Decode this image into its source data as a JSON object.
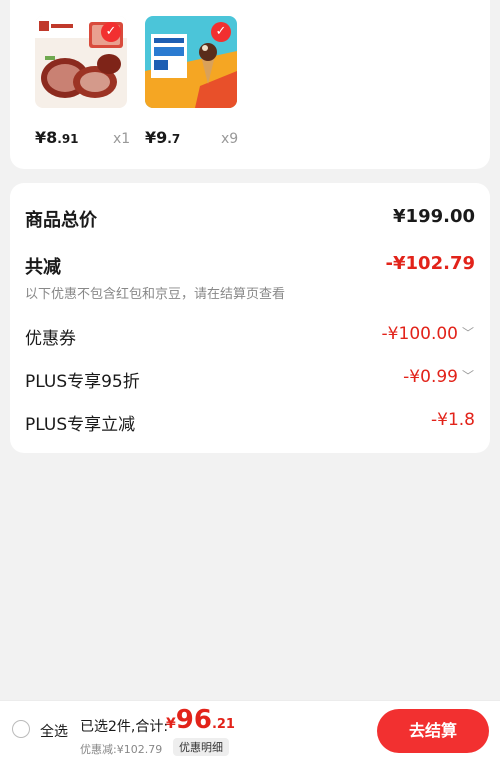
{
  "products": [
    {
      "price_int": "¥8",
      "price_dec": ".91",
      "qty": "x1",
      "image": "braised-meat-photo"
    },
    {
      "price_int": "¥9",
      "price_dec": ".7",
      "qty": "x9",
      "image": "ice-cream-promo-photo"
    }
  ],
  "summary": {
    "total_label": "商品总价",
    "total_value": "¥199.00",
    "reduce_label": "共减",
    "reduce_value": "-¥102.79",
    "note": "以下优惠不包含红包和京豆，请在结算页查看",
    "coupon_label": "优惠券",
    "coupon_value": "-¥100.00",
    "plus_discount_label": "PLUS专享95折",
    "plus_discount_value": "-¥0.99",
    "plus_reduce_label": "PLUS专享立减",
    "plus_reduce_value": "-¥1.8"
  },
  "bottom": {
    "select_all": "全选",
    "selected_text": "已选2件,合计:",
    "total_yen": "¥",
    "total_int": "96",
    "total_dec": ".21",
    "discount_text": "优惠减:¥102.79",
    "detail_button": "优惠明细",
    "checkout_button": "去结算"
  },
  "colors": {
    "accent": "#e2231a",
    "checkout": "#f23030",
    "background": "#f2f2f2"
  }
}
